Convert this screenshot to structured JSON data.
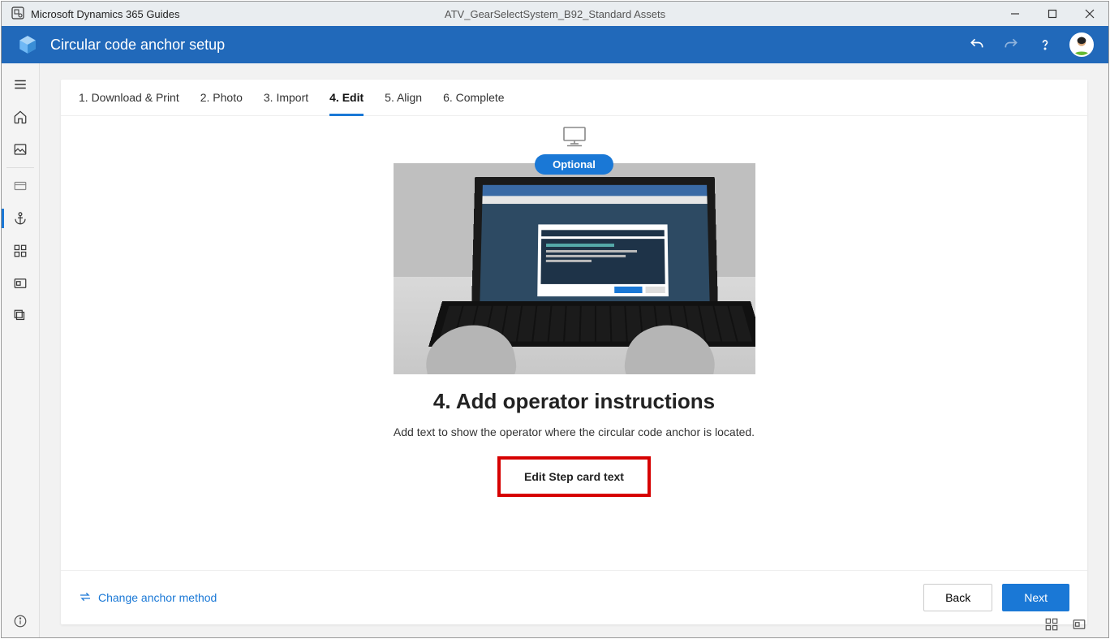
{
  "titlebar": {
    "app_name": "Microsoft Dynamics 365 Guides",
    "document": "ATV_GearSelectSystem_B92_Standard Assets"
  },
  "commandbar": {
    "title": "Circular code anchor setup"
  },
  "tabs": [
    {
      "label": "1. Download & Print"
    },
    {
      "label": "2. Photo"
    },
    {
      "label": "3. Import"
    },
    {
      "label": "4. Edit"
    },
    {
      "label": "5. Align"
    },
    {
      "label": "6. Complete"
    }
  ],
  "active_tab_index": 3,
  "main": {
    "badge": "Optional",
    "heading": "4. Add operator instructions",
    "description": "Add text to show the operator where the circular code anchor is located.",
    "edit_button": "Edit Step card text"
  },
  "footer": {
    "change_link": "Change anchor method",
    "back": "Back",
    "next": "Next"
  }
}
